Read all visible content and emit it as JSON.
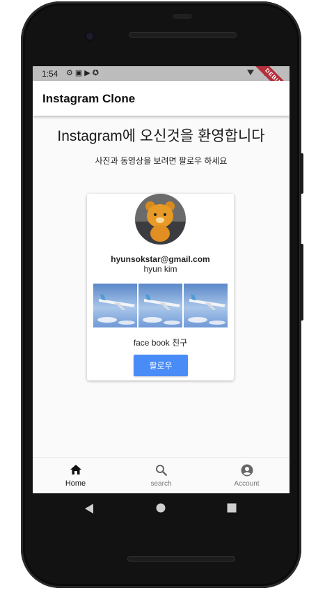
{
  "status_bar": {
    "time": "1:54",
    "icons": [
      "gear-icon",
      "image-icon",
      "play-icon",
      "sync-icon"
    ],
    "debug_label": "DEBUG"
  },
  "app_bar": {
    "title": "Instagram Clone"
  },
  "main": {
    "welcome": "Instagram에 오신것을 환영합니다",
    "subtitle": "사진과 동영상을 보려면 팔로우 하세요"
  },
  "card": {
    "email": "hyunsokstar@gmail.com",
    "name": "hyun kim",
    "photos": [
      "airplane-photo-1",
      "airplane-photo-2",
      "airplane-photo-3"
    ],
    "description": "face book 친구",
    "follow_label": "팔로우"
  },
  "bottom_nav": {
    "items": [
      {
        "label": "Home",
        "icon": "home-icon",
        "active": true
      },
      {
        "label": "search",
        "icon": "search-icon",
        "active": false
      },
      {
        "label": "Account",
        "icon": "account-icon",
        "active": false
      }
    ]
  },
  "colors": {
    "accent": "#4a8cf7",
    "debug_banner": "#b4303c",
    "status_bar": "#bdbdbd"
  }
}
